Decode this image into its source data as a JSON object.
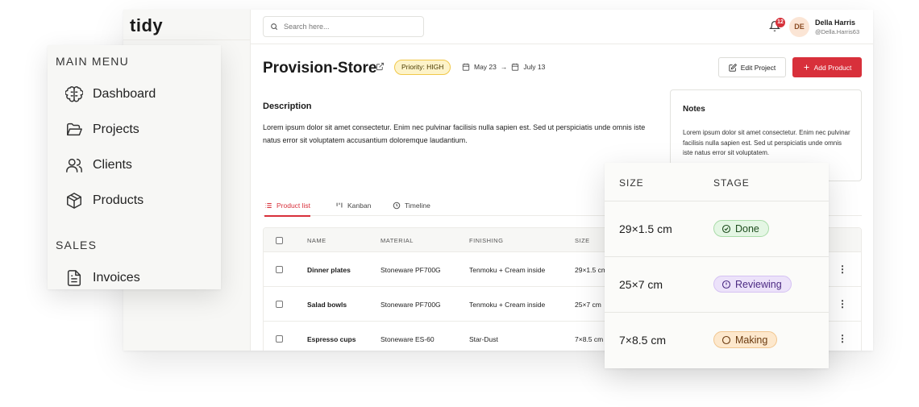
{
  "app": {
    "logo": "tidy",
    "search": {
      "placeholder": "Search here..."
    },
    "notifications": {
      "count": "12"
    },
    "user": {
      "initials": "DE",
      "name": "Della Harris",
      "handle": "@Della.Harris63"
    }
  },
  "project": {
    "title": "Provision-Store",
    "priority": "Priority: HIGH",
    "start_date": "May 23",
    "arrow": "→",
    "end_date": "July 13",
    "edit_label": "Edit Project",
    "add_label": "Add Product",
    "description_title": "Description",
    "description": "Lorem ipsum dolor sit amet consectetur. Enim nec pulvinar facilisis nulla sapien est. Sed ut perspiciatis unde omnis iste natus error sit voluptatem accusantium doloremque laudantium.",
    "notes_title": "Notes",
    "notes": "Lorem ipsum dolor sit amet consectetur. Enim nec pulvinar facilisis nulla sapien est. Sed ut perspiciatis unde omnis iste natus error sit voluptatem."
  },
  "tabs": [
    {
      "label": "Product list",
      "icon": "list-icon",
      "active": true
    },
    {
      "label": "Kanban",
      "icon": "kanban-icon",
      "active": false
    },
    {
      "label": "Timeline",
      "icon": "clock-icon",
      "active": false
    }
  ],
  "table": {
    "headers": [
      "NAME",
      "MATERIAL",
      "FINISHING",
      "SIZE"
    ],
    "rows": [
      {
        "name": "Dinner plates",
        "material": "Stoneware PF700G",
        "finishing": "Tenmoku + Cream inside",
        "size": "29×1.5 cm"
      },
      {
        "name": "Salad bowls",
        "material": "Stoneware PF700G",
        "finishing": "Tenmoku + Cream inside",
        "size": "25×7 cm"
      },
      {
        "name": "Espresso cups",
        "material": "Stoneware ES-60",
        "finishing": "Star-Dust",
        "size": "7×8.5 cm"
      }
    ]
  },
  "menu": {
    "main_title": "MAIN MENU",
    "items": [
      {
        "label": "Dashboard",
        "icon": "brain-icon"
      },
      {
        "label": "Projects",
        "icon": "folder-open-icon"
      },
      {
        "label": "Clients",
        "icon": "users-icon"
      },
      {
        "label": "Products",
        "icon": "box-icon"
      }
    ],
    "sales_title": "SALES",
    "sales_items": [
      {
        "label": "Invoices",
        "icon": "file-text-icon"
      }
    ]
  },
  "stage_card": {
    "size_header": "SIZE",
    "stage_header": "STAGE",
    "rows": [
      {
        "size": "29×1.5 cm",
        "stage": "Done",
        "icon": "check-circle-icon"
      },
      {
        "size": "25×7 cm",
        "stage": "Reviewing",
        "icon": "alert-circle-icon"
      },
      {
        "size": "7×8.5 cm",
        "stage": "Making",
        "icon": "circle-icon"
      }
    ]
  },
  "colors": {
    "accent": "#d8303b",
    "priority_bg": "#fdf3c9",
    "done_bg": "#e4f6e4",
    "review_bg": "#ece2fa",
    "making_bg": "#fde8cd"
  }
}
